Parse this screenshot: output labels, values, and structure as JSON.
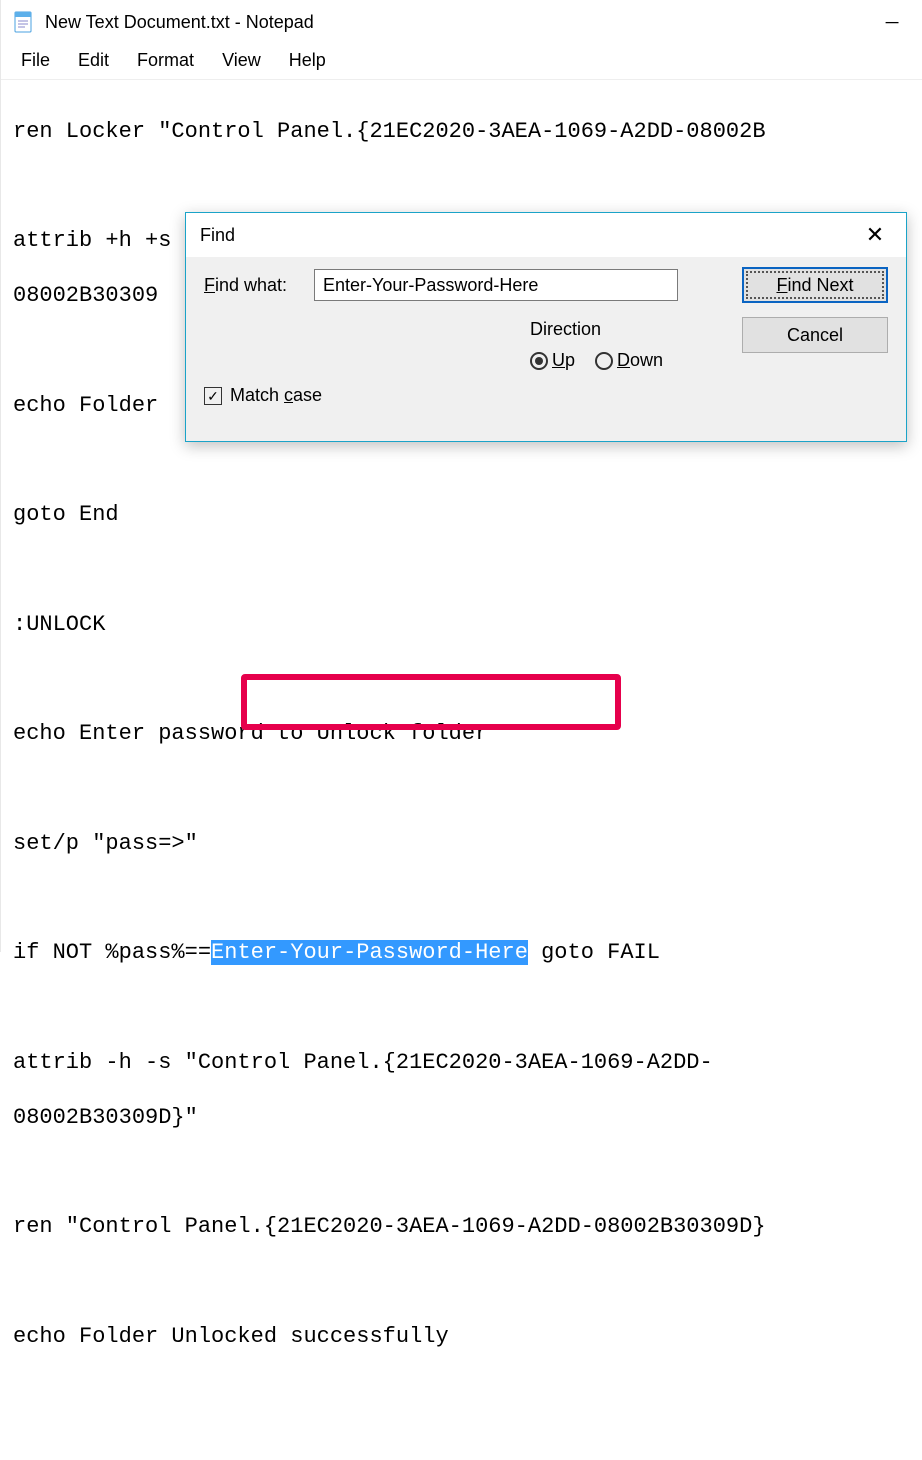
{
  "window": {
    "title": "New Text Document.txt - Notepad"
  },
  "menu": {
    "file": "File",
    "edit": "Edit",
    "format": "Format",
    "view": "View",
    "help": "Help"
  },
  "editor": {
    "line1": "ren Locker \"Control Panel.{21EC2020-3AEA-1069-A2DD-08002B",
    "line2a": "attrib +h +s \"Control Panel.{21EC2020-3AEA-1069-A2DD-",
    "line2b": "08002B30309",
    "line3": "echo Folder",
    "line4": "goto End",
    "line5": ":UNLOCK",
    "line6": "echo Enter password to Unlock folder",
    "line7": "set/p \"pass=>\"",
    "line8a": "if NOT %pass%==",
    "line8sel": "Enter-Your-Password-Here",
    "line8b": " goto FAIL",
    "line9a": "attrib -h -s \"Control Panel.{21EC2020-3AEA-1069-A2DD-",
    "line9b": "08002B30309D}\"",
    "line10": "ren \"Control Panel.{21EC2020-3AEA-1069-A2DD-08002B30309D}",
    "line11": "echo Folder Unlocked successfully"
  },
  "find": {
    "title": "Find",
    "label": "Find what:",
    "value": "Enter-Your-Password-Here",
    "findNext": "Find Next",
    "cancel": "Cancel",
    "direction": "Direction",
    "up": "Up",
    "down": "Down",
    "matchCase": "Match case",
    "upSelected": true,
    "matchCaseChecked": true
  }
}
